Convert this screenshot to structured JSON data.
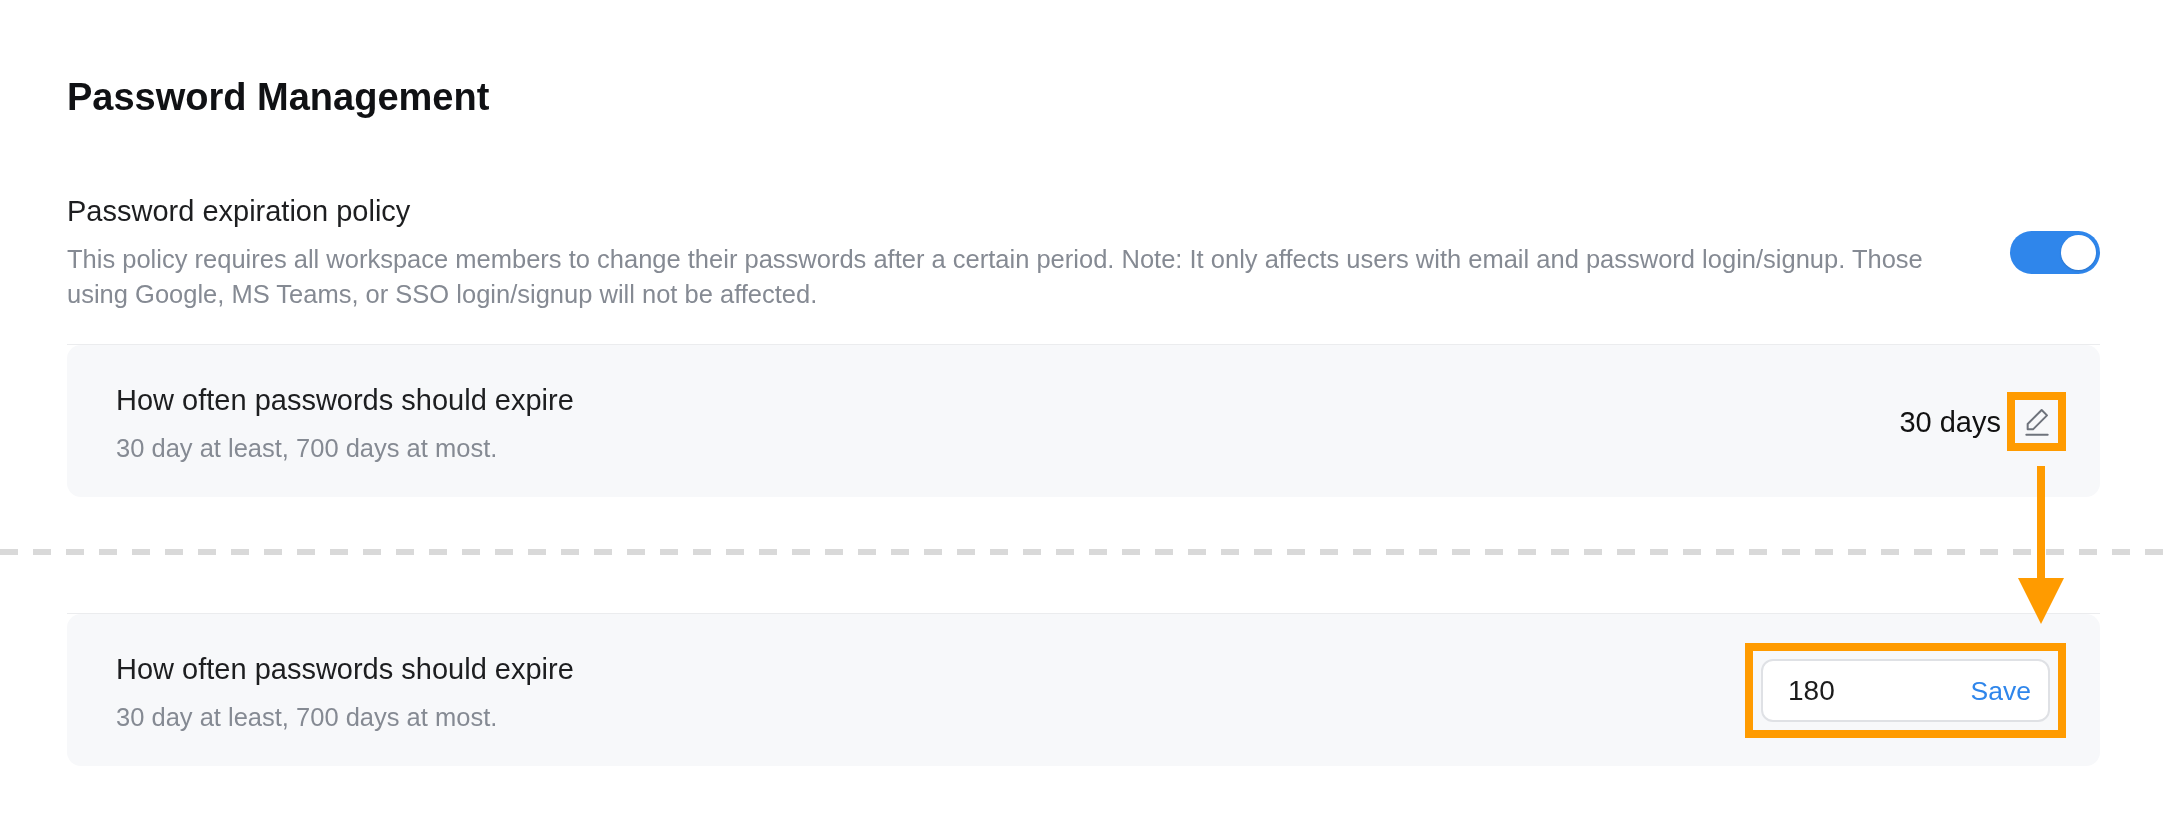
{
  "heading": "Password Management",
  "policy": {
    "label": "Password expiration policy",
    "description": "This policy requires all workspace members to change their passwords after a certain period. Note: It only affects users with email and password login/signup. Those using Google, MS Teams, or SSO login/signup will not be affected.",
    "on": true
  },
  "panels": [
    {
      "kind": "display",
      "label": "How often passwords should expire",
      "description": "30 day at least, 700 days at most.",
      "value": "30 days",
      "highlighted": true
    },
    {
      "kind": "edit",
      "label": "How often passwords should expire",
      "description": "30 day at least, 700 days at most.",
      "value": "180",
      "button": "Save",
      "highlighted": true
    }
  ]
}
